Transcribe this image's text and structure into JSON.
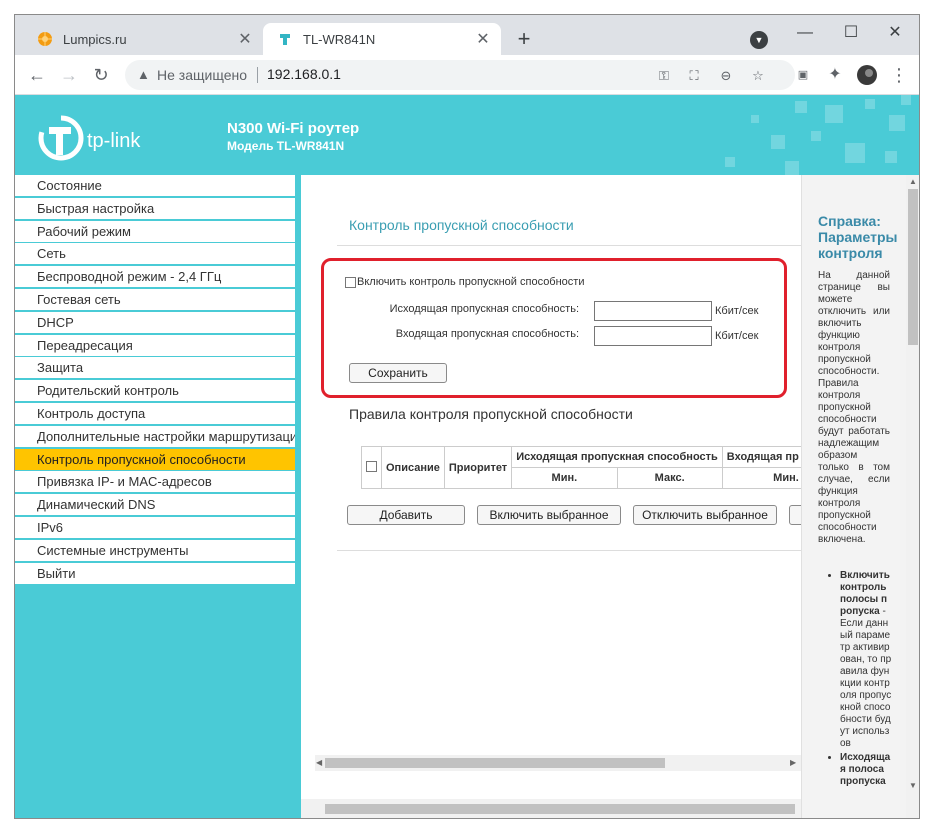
{
  "browser": {
    "tabs": [
      {
        "title": "Lumpics.ru",
        "close": "✕"
      },
      {
        "title": "TL-WR841N",
        "close": "✕"
      }
    ],
    "new_tab": "+",
    "window_controls": {
      "minimize": "—",
      "maximize": "☐",
      "close": "✕"
    },
    "toolbar": {
      "back": "←",
      "forward": "→",
      "reload": "↻",
      "menu": "⋮"
    },
    "address": {
      "security_text": "Не защищено",
      "url": "192.168.0.1"
    },
    "accent": "#4acbd6"
  },
  "router": {
    "brand": "tp-link",
    "model_title": "N300 Wi-Fi роутер",
    "model_subtitle": "Модель TL-WR841N"
  },
  "menu": {
    "items": [
      "Состояние",
      "Быстрая настройка",
      "Рабочий режим",
      "Сеть",
      "Беспроводной режим - 2,4 ГГц",
      "Гостевая сеть",
      "DHCP",
      "Переадресация",
      "Защита",
      "Родительский контроль",
      "Контроль доступа",
      "Дополнительные настройки маршрутизации",
      "Контроль пропускной способности",
      "Привязка IP- и MAC-адресов",
      "Динамический DNS",
      "IPv6",
      "Системные инструменты",
      "Выйти"
    ],
    "active_index": 12
  },
  "content": {
    "header": "Контроль пропускной способности",
    "enable_label": "Включить контроль пропускной способности",
    "upload_label": "Исходящая пропускная способность:",
    "download_label": "Входящая пропускная способность:",
    "upload_value": "",
    "download_value": "",
    "unit": "Кбит/сек",
    "save_button": "Сохранить",
    "rules_title": "Правила контроля пропускной способности",
    "table": {
      "col_desc": "Описание",
      "col_priority": "Приоритет",
      "col_upload": "Исходящая пропускная способность",
      "col_download": "Входящая пр",
      "min": "Мин.",
      "max": "Макс."
    },
    "buttons": {
      "add": "Добавить",
      "enable_selected": "Включить выбранное",
      "disable_selected": "Отключить выбранное"
    }
  },
  "help": {
    "title": "Справка: Параметры контроля",
    "body": "На данной странице вы можете отключить или включить функцию контроля пропускной способности. Правила контроля пропускной способности будут работать надлежащим образом только в том случае, если функция контроля пропускной способности включена.",
    "bullet1_title": "Включить контроль полосы пропуска",
    "bullet1_text": " - Если данный параметр активирован, то правила функции контроля пропускной способности будут использов",
    "bullet2_title": "Исходящая полоса пропуска"
  }
}
